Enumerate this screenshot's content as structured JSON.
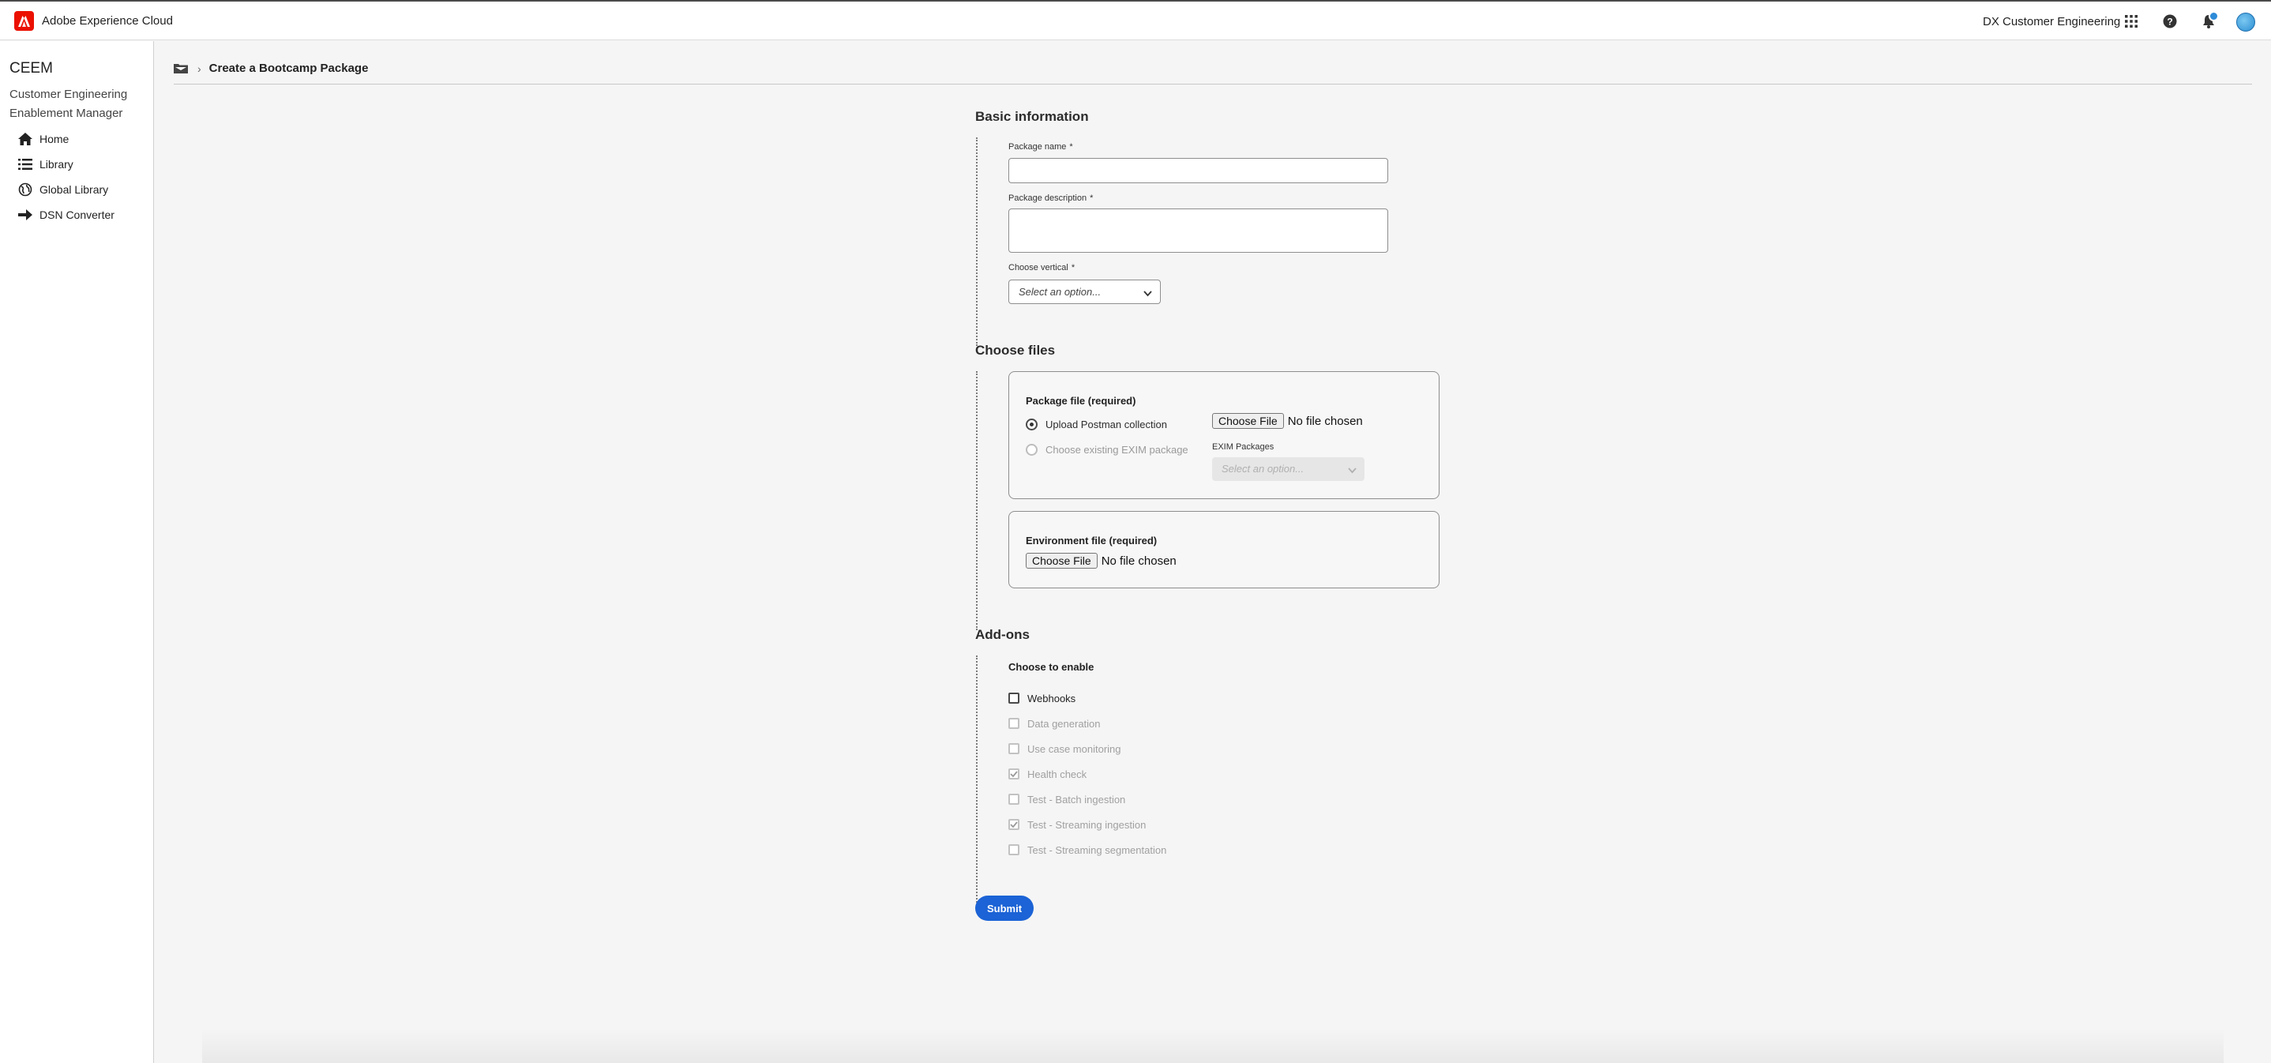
{
  "topbar": {
    "brand": "Adobe Experience Cloud",
    "org": "DX Customer Engineering",
    "icons": [
      "adobe-logo-icon",
      "apps-grid-icon",
      "help-icon",
      "bell-icon"
    ]
  },
  "sidebar": {
    "title": "CEEM",
    "subtitle": "Customer Engineering Enablement Manager",
    "items": [
      {
        "label": "Home",
        "icon": "home-icon"
      },
      {
        "label": "Library",
        "icon": "list-icon"
      },
      {
        "label": "Global Library",
        "icon": "globe-icon"
      },
      {
        "label": "DSN Converter",
        "icon": "arrow-right-icon"
      }
    ]
  },
  "breadcrumb": {
    "current": "Create a Bootcamp Package"
  },
  "basic": {
    "title": "Basic information",
    "name_label": "Package name",
    "desc_label": "Package description",
    "vertical_label": "Choose vertical",
    "required_mark": "*",
    "vertical_placeholder": "Select an option..."
  },
  "files": {
    "title": "Choose files",
    "package_box_title": "Package file (required)",
    "radio_upload": "Upload Postman collection",
    "radio_existing": "Choose existing EXIM package",
    "choose_file": "Choose File",
    "no_file": "No file chosen",
    "exim_label": "EXIM Packages",
    "exim_placeholder": "Select an option...",
    "env_box_title": "Environment file (required)"
  },
  "addons": {
    "title": "Add-ons",
    "heading": "Choose to enable",
    "items": [
      {
        "label": "Webhooks",
        "checked": false,
        "disabled": false
      },
      {
        "label": "Data generation",
        "checked": false,
        "disabled": true
      },
      {
        "label": "Use case monitoring",
        "checked": false,
        "disabled": true
      },
      {
        "label": "Health check",
        "checked": true,
        "disabled": true
      },
      {
        "label": "Test - Batch ingestion",
        "checked": false,
        "disabled": true
      },
      {
        "label": "Test - Streaming ingestion",
        "checked": true,
        "disabled": true
      },
      {
        "label": "Test - Streaming segmentation",
        "checked": false,
        "disabled": true
      }
    ]
  },
  "submit_label": "Submit",
  "colors": {
    "accent": "#1b63d6",
    "brand_red": "#eb1000"
  }
}
